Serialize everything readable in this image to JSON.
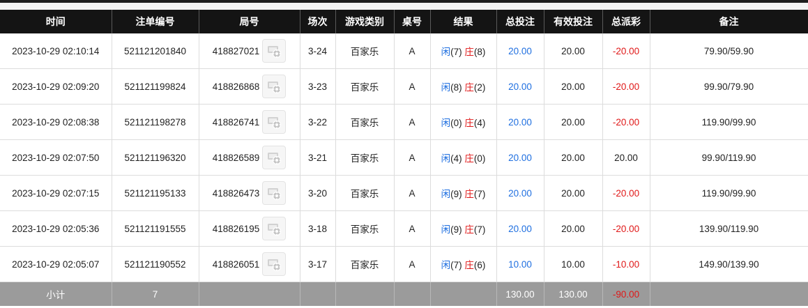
{
  "columns": [
    "时间",
    "注单编号",
    "局号",
    "场次",
    "游戏类别",
    "桌号",
    "结果",
    "总投注",
    "有效投注",
    "总派彩",
    "备注"
  ],
  "rows": [
    {
      "time": "2023-10-29 02:10:14",
      "order_no": "521121201840",
      "round_no": "418827021",
      "session": "3-24",
      "game": "百家乐",
      "table": "A",
      "player_label": "闲",
      "player_score": "(7)",
      "banker_label": "庄",
      "banker_score": "(8)",
      "total_bet": "20.00",
      "valid_bet": "20.00",
      "payout": "-20.00",
      "payout_negative": true,
      "note": "79.90/59.90"
    },
    {
      "time": "2023-10-29 02:09:20",
      "order_no": "521121199824",
      "round_no": "418826868",
      "session": "3-23",
      "game": "百家乐",
      "table": "A",
      "player_label": "闲",
      "player_score": "(8)",
      "banker_label": "庄",
      "banker_score": "(2)",
      "total_bet": "20.00",
      "valid_bet": "20.00",
      "payout": "-20.00",
      "payout_negative": true,
      "note": "99.90/79.90"
    },
    {
      "time": "2023-10-29 02:08:38",
      "order_no": "521121198278",
      "round_no": "418826741",
      "session": "3-22",
      "game": "百家乐",
      "table": "A",
      "player_label": "闲",
      "player_score": "(0)",
      "banker_label": "庄",
      "banker_score": "(4)",
      "total_bet": "20.00",
      "valid_bet": "20.00",
      "payout": "-20.00",
      "payout_negative": true,
      "note": "119.90/99.90"
    },
    {
      "time": "2023-10-29 02:07:50",
      "order_no": "521121196320",
      "round_no": "418826589",
      "session": "3-21",
      "game": "百家乐",
      "table": "A",
      "player_label": "闲",
      "player_score": "(4)",
      "banker_label": "庄",
      "banker_score": "(0)",
      "total_bet": "20.00",
      "valid_bet": "20.00",
      "payout": "20.00",
      "payout_negative": false,
      "note": "99.90/119.90"
    },
    {
      "time": "2023-10-29 02:07:15",
      "order_no": "521121195133",
      "round_no": "418826473",
      "session": "3-20",
      "game": "百家乐",
      "table": "A",
      "player_label": "闲",
      "player_score": "(9)",
      "banker_label": "庄",
      "banker_score": "(7)",
      "total_bet": "20.00",
      "valid_bet": "20.00",
      "payout": "-20.00",
      "payout_negative": true,
      "note": "119.90/99.90"
    },
    {
      "time": "2023-10-29 02:05:36",
      "order_no": "521121191555",
      "round_no": "418826195",
      "session": "3-18",
      "game": "百家乐",
      "table": "A",
      "player_label": "闲",
      "player_score": "(9)",
      "banker_label": "庄",
      "banker_score": "(7)",
      "total_bet": "20.00",
      "valid_bet": "20.00",
      "payout": "-20.00",
      "payout_negative": true,
      "note": "139.90/119.90"
    },
    {
      "time": "2023-10-29 02:05:07",
      "order_no": "521121190552",
      "round_no": "418826051",
      "session": "3-17",
      "game": "百家乐",
      "table": "A",
      "player_label": "闲",
      "player_score": "(7)",
      "banker_label": "庄",
      "banker_score": "(6)",
      "total_bet": "10.00",
      "valid_bet": "10.00",
      "payout": "-10.00",
      "payout_negative": true,
      "note": "149.90/139.90"
    }
  ],
  "subtotal": {
    "label": "小计",
    "count": "7",
    "total_bet": "130.00",
    "valid_bet": "130.00",
    "payout": "-90.00"
  },
  "colors": {
    "header_bg": "#141414",
    "subtotal_bg": "#9b9b9b",
    "player": "#1f6fe0",
    "banker": "#e01818",
    "negative": "#e01818"
  },
  "icons": {
    "ticket_icon": "game-replay-icon"
  }
}
